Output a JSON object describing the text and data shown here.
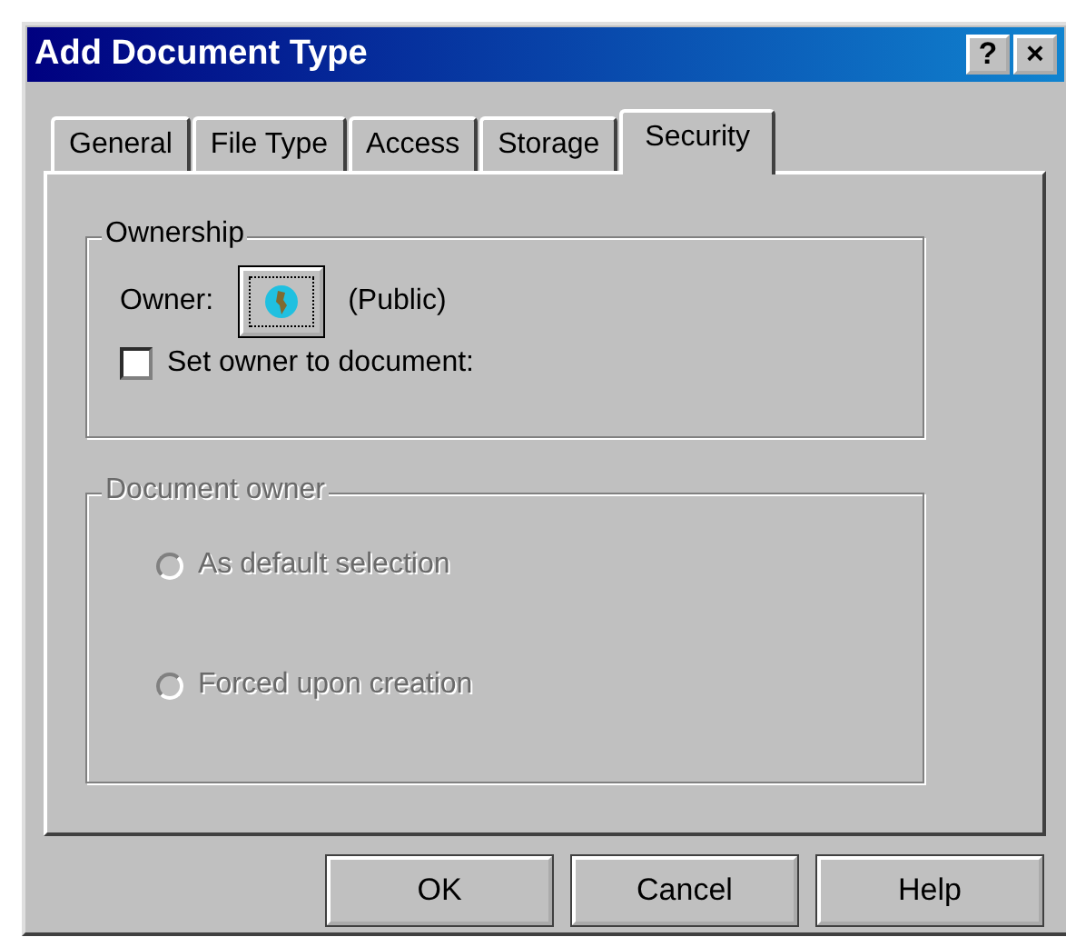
{
  "window": {
    "title": "Add Document Type",
    "help_button": "?",
    "close_button": "×"
  },
  "tabs": [
    {
      "label": "General",
      "selected": false
    },
    {
      "label": "File Type",
      "selected": false
    },
    {
      "label": "Access",
      "selected": false
    },
    {
      "label": "Storage",
      "selected": false
    },
    {
      "label": "Security",
      "selected": true
    }
  ],
  "ownership": {
    "title": "Ownership",
    "owner_label": "Owner:",
    "owner_value": "(Public)",
    "set_owner": {
      "label": "Set owner to document:",
      "checked": false
    }
  },
  "document_owner": {
    "title": "Document owner",
    "disabled": true,
    "options": [
      {
        "label": "As default selection",
        "selected": false
      },
      {
        "label": "Forced upon creation",
        "selected": false
      }
    ]
  },
  "buttons": [
    "OK",
    "Cancel",
    "Help"
  ]
}
